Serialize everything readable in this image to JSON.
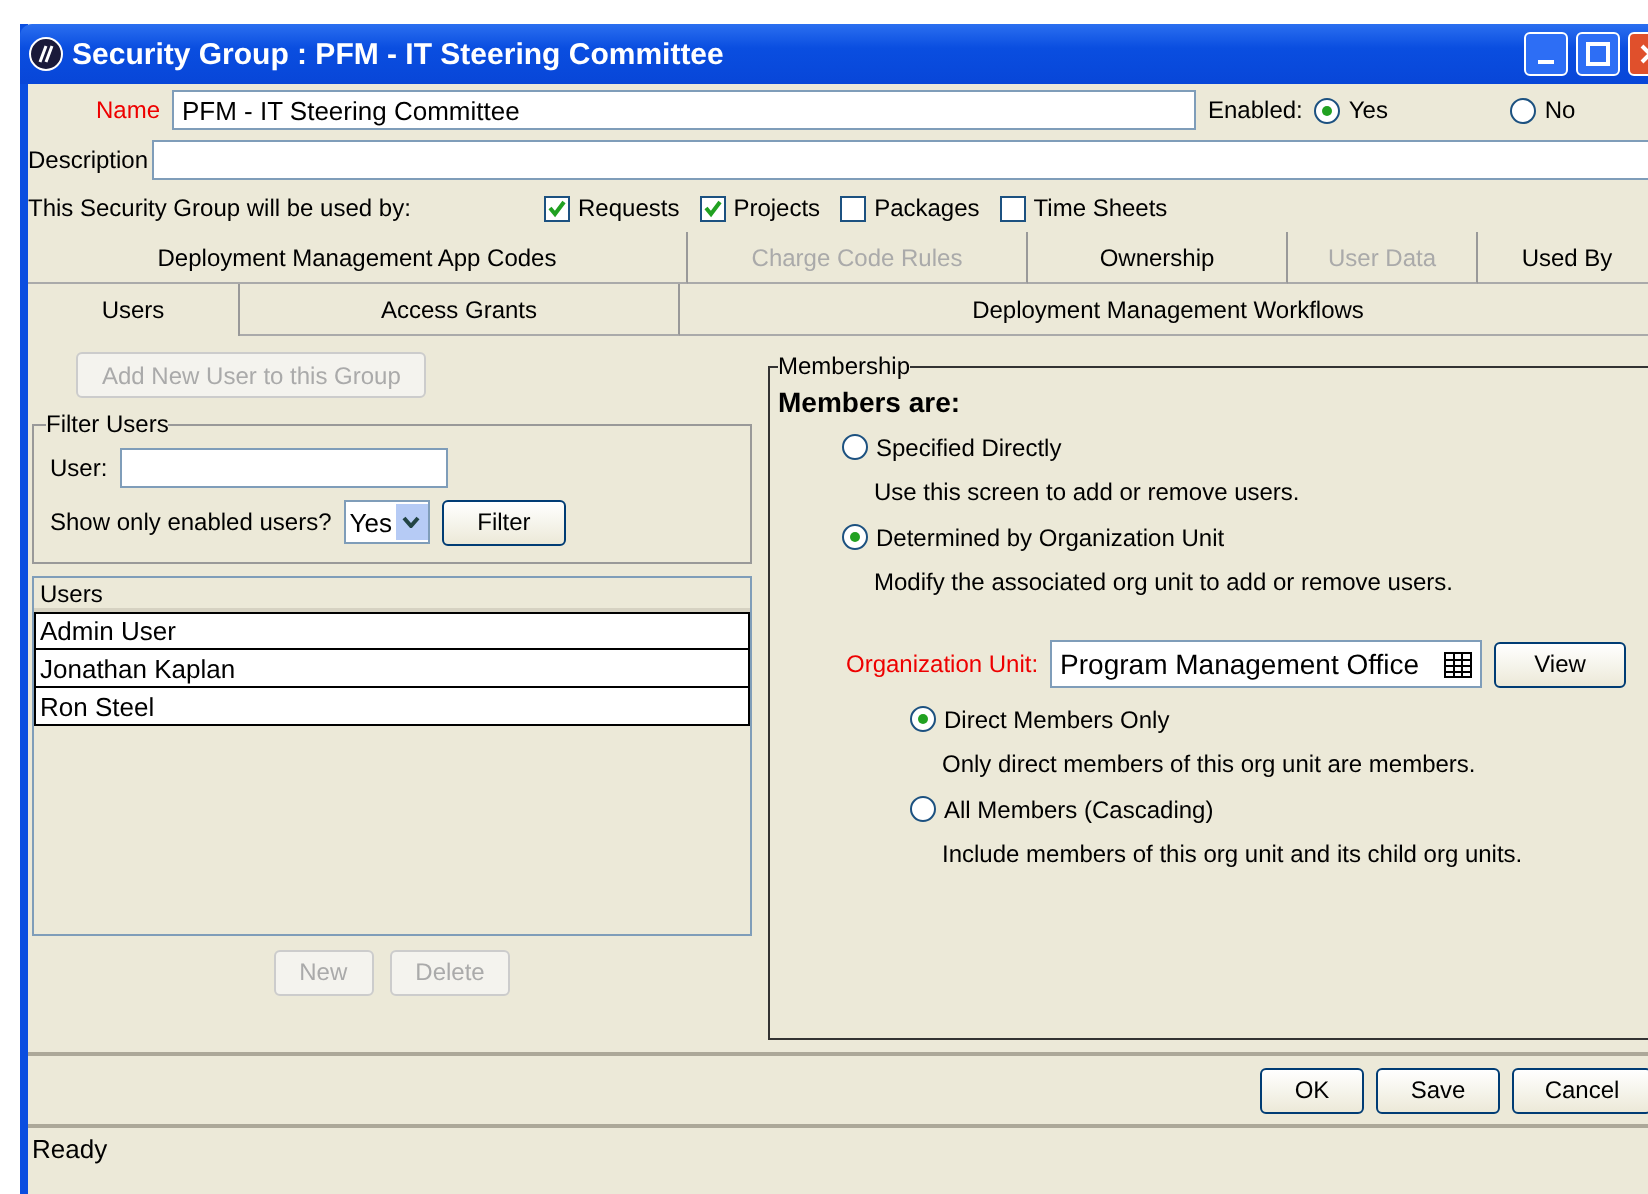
{
  "window": {
    "title": "Security Group : PFM - IT Steering Committee"
  },
  "name": {
    "label": "Name",
    "value": "PFM - IT Steering Committee"
  },
  "enabled": {
    "label": "Enabled:",
    "options": [
      {
        "label": "Yes",
        "selected": true
      },
      {
        "label": "No",
        "selected": false
      }
    ]
  },
  "description": {
    "label": "Description"
  },
  "used_by": {
    "label": "This Security Group will be used by:",
    "options": [
      {
        "label": "Requests",
        "checked": true
      },
      {
        "label": "Projects",
        "checked": true
      },
      {
        "label": "Packages",
        "checked": false
      },
      {
        "label": "Time Sheets",
        "checked": false
      }
    ]
  },
  "tab_rows": [
    [
      {
        "label": "Deployment Management App Codes",
        "selected": false,
        "disabled": false
      },
      {
        "label": "Charge Code Rules",
        "selected": false,
        "disabled": true
      },
      {
        "label": "Ownership",
        "selected": false,
        "disabled": false
      },
      {
        "label": "User Data",
        "selected": false,
        "disabled": true
      },
      {
        "label": "Used By",
        "selected": false,
        "disabled": false
      }
    ],
    [
      {
        "label": "Users",
        "selected": true,
        "disabled": false
      },
      {
        "label": "Access Grants",
        "selected": false,
        "disabled": false
      },
      {
        "label": "Deployment Management Workflows",
        "selected": false,
        "disabled": false
      }
    ]
  ],
  "add_user_button": {
    "label": "Add New User to this Group",
    "disabled": true
  },
  "filter": {
    "title": "Filter Users",
    "user_label": "User:",
    "enabled_label": "Show only enabled users?",
    "enabled_value": "Yes",
    "button": "Filter"
  },
  "users_table": {
    "column": "Users",
    "rows": [
      "Admin User",
      "Jonathan Kaplan",
      "Ron Steel"
    ]
  },
  "list_buttons": [
    {
      "label": "New",
      "disabled": true
    },
    {
      "label": "Delete",
      "disabled": true
    }
  ],
  "membership": {
    "title": "Membership",
    "heading": "Members are:",
    "options": [
      {
        "label": "Specified Directly",
        "hint": "Use this screen to add or remove users.",
        "selected": false
      },
      {
        "label": "Determined by Organization Unit",
        "hint": "Modify the associated org unit to add or remove users.",
        "selected": true
      }
    ],
    "org_unit": {
      "label": "Organization Unit:",
      "value": "Program Management Office",
      "button": "View"
    },
    "scope_options": [
      {
        "label": "Direct Members Only",
        "hint": "Only direct members of this org unit are members.",
        "selected": true
      },
      {
        "label": "All Members (Cascading)",
        "hint": "Include members of this org unit and its child org units.",
        "selected": false
      }
    ]
  },
  "footer_buttons": [
    "OK",
    "Save",
    "Cancel"
  ],
  "status_bar": "Ready"
}
